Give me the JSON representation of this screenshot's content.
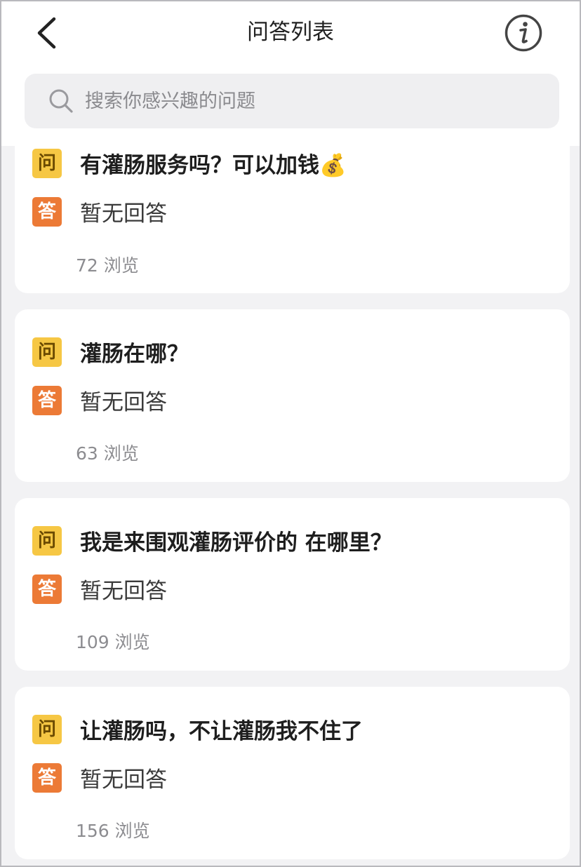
{
  "header": {
    "title": "问答列表"
  },
  "search": {
    "placeholder": "搜索你感兴趣的问题"
  },
  "labels": {
    "question_badge": "问",
    "answer_badge": "答"
  },
  "questions": [
    {
      "question": "有灌肠服务吗？可以加钱💰",
      "answer": "暂无回答",
      "views": "72 浏览"
    },
    {
      "question": "灌肠在哪？",
      "answer": "暂无回答",
      "views": "63 浏览"
    },
    {
      "question": "我是来围观灌肠评价的 在哪里？",
      "answer": "暂无回答",
      "views": "109 浏览"
    },
    {
      "question": "让灌肠吗，不让灌肠我不住了",
      "answer": "暂无回答",
      "views": "156 浏览"
    }
  ]
}
